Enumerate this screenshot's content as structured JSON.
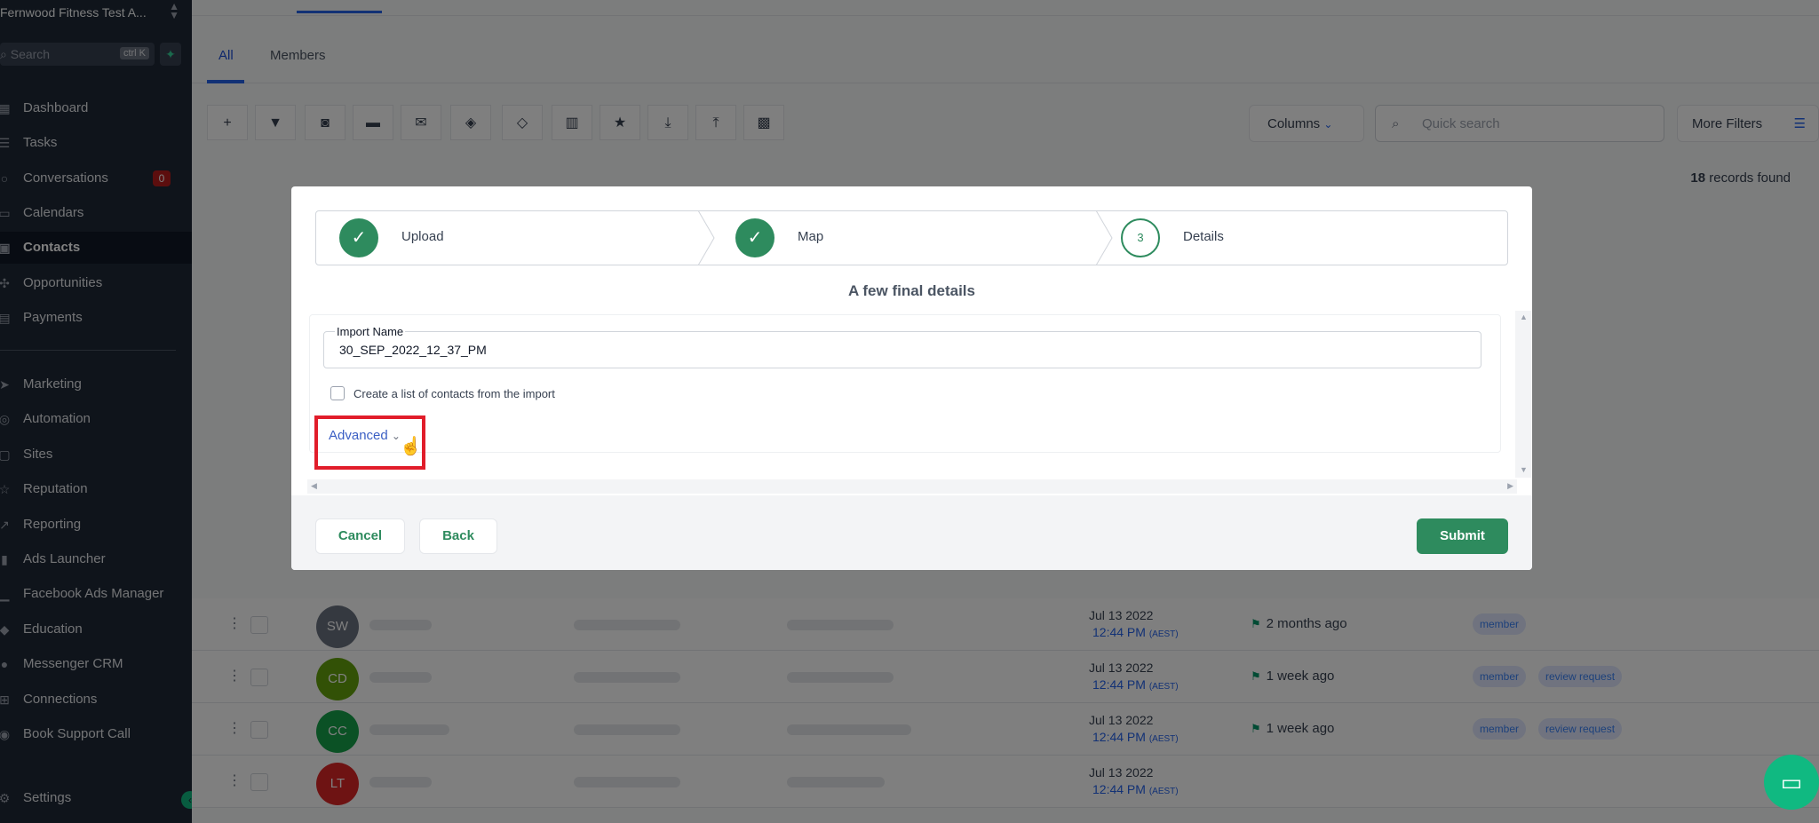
{
  "sidebar": {
    "account_name": "Fernwood Fitness Test A...",
    "search_placeholder": "Search",
    "search_shortcut": "ctrl K",
    "conversations_badge": "0",
    "items": [
      {
        "label": "Dashboard",
        "icon": "dashboard-icon"
      },
      {
        "label": "Tasks",
        "icon": "tasks-icon"
      },
      {
        "label": "Conversations",
        "icon": "chat-icon"
      },
      {
        "label": "Calendars",
        "icon": "calendar-icon"
      },
      {
        "label": "Contacts",
        "icon": "contacts-icon"
      },
      {
        "label": "Opportunities",
        "icon": "opportunities-icon"
      },
      {
        "label": "Payments",
        "icon": "payments-icon"
      },
      {
        "label": "Marketing",
        "icon": "send-icon"
      },
      {
        "label": "Automation",
        "icon": "automation-icon"
      },
      {
        "label": "Sites",
        "icon": "sites-icon"
      },
      {
        "label": "Reputation",
        "icon": "star-icon"
      },
      {
        "label": "Reporting",
        "icon": "chart-icon"
      },
      {
        "label": "Ads Launcher",
        "icon": "ads-icon"
      },
      {
        "label": "Facebook Ads Manager",
        "icon": "bar-icon"
      },
      {
        "label": "Education",
        "icon": "cap-icon"
      },
      {
        "label": "Messenger CRM",
        "icon": "messenger-icon"
      },
      {
        "label": "Connections",
        "icon": "connections-icon"
      },
      {
        "label": "Book Support Call",
        "icon": "headset-icon"
      },
      {
        "label": "Settings",
        "icon": "gear-icon"
      }
    ]
  },
  "tabs": {
    "all": "All",
    "members": "Members"
  },
  "toolbar": {
    "columns_label": "Columns",
    "quick_search_placeholder": "Quick search",
    "more_filters_label": "More Filters"
  },
  "records": {
    "count": "18",
    "suffix": " records found"
  },
  "rows": [
    {
      "initials": "SW",
      "color": "#6b7280",
      "date": "Jul 13 2022",
      "time": "12:44 PM",
      "tz": "(AEST)",
      "activity": "2 months ago",
      "tags": [
        "member"
      ]
    },
    {
      "initials": "CD",
      "color": "#65a30d",
      "date": "Jul 13 2022",
      "time": "12:44 PM",
      "tz": "(AEST)",
      "activity": "1 week ago",
      "tags": [
        "member",
        "review request"
      ]
    },
    {
      "initials": "CC",
      "color": "#16a34a",
      "date": "Jul 13 2022",
      "time": "12:44 PM",
      "tz": "(AEST)",
      "activity": "1 week ago",
      "tags": [
        "member",
        "review request"
      ]
    },
    {
      "initials": "LT",
      "color": "#dc2626",
      "date": "Jul 13 2022",
      "time": "12:44 PM",
      "tz": "(AEST)",
      "activity": "",
      "tags": []
    }
  ],
  "modal": {
    "steps": [
      {
        "label": "Upload",
        "state": "done"
      },
      {
        "label": "Map",
        "state": "done"
      },
      {
        "label": "Details",
        "state": "current",
        "number": "3"
      }
    ],
    "heading": "A few final details",
    "import_name_label": "Import Name",
    "import_name_value": "30_SEP_2022_12_37_PM",
    "create_list_label": "Create a list of contacts from the import",
    "advanced_label": "Advanced",
    "cancel_label": "Cancel",
    "back_label": "Back",
    "submit_label": "Submit"
  }
}
